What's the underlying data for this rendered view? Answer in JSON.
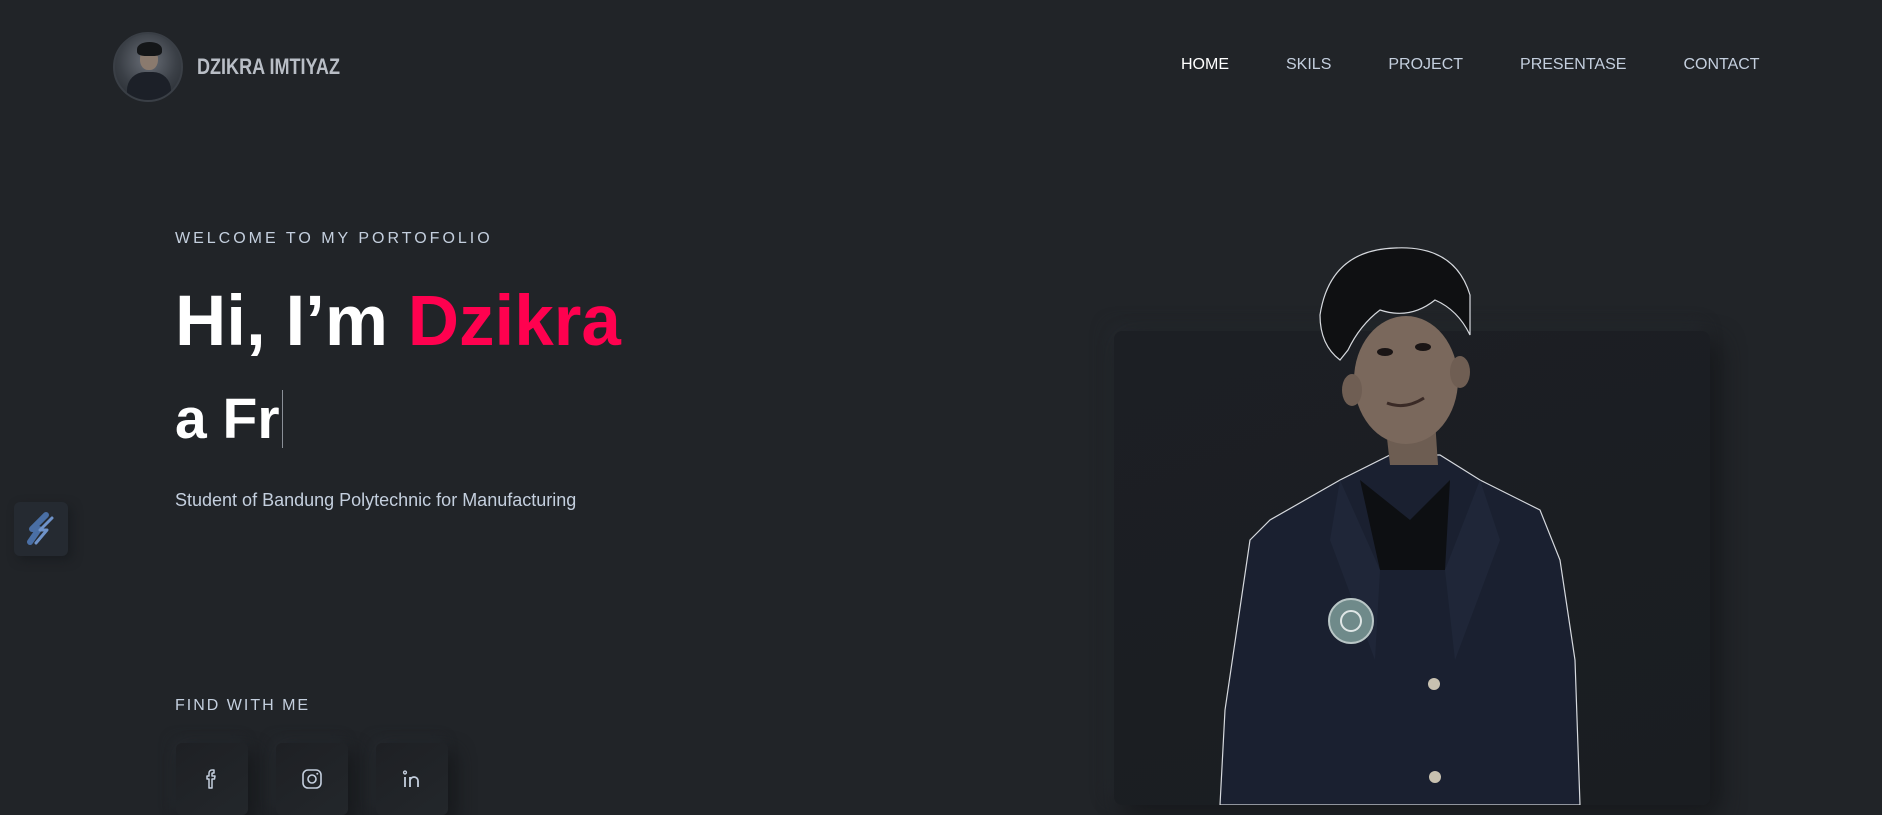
{
  "brand": {
    "name": "DZIKRA IMTIYAZ"
  },
  "nav": {
    "items": [
      {
        "label": "HOME",
        "active": true
      },
      {
        "label": "SKILS",
        "active": false
      },
      {
        "label": "PROJECT",
        "active": false
      },
      {
        "label": "PRESENTASE",
        "active": false
      },
      {
        "label": "CONTACT",
        "active": false
      }
    ]
  },
  "hero": {
    "welcome": "WELCOME TO MY PORTOFOLIO",
    "greeting": "Hi, I’m ",
    "name": "Dzikra",
    "typed_text": "a Fr",
    "subtitle": "Student of Bandung Polytechnic for Manufacturing",
    "find_label": "FIND WITH ME",
    "socials": [
      {
        "icon": "facebook-icon"
      },
      {
        "icon": "instagram-icon"
      },
      {
        "icon": "linkedin-icon"
      }
    ]
  },
  "colors": {
    "background": "#212428",
    "accent": "#ff014f",
    "text": "#c4cfde",
    "heading": "#ffffff"
  }
}
